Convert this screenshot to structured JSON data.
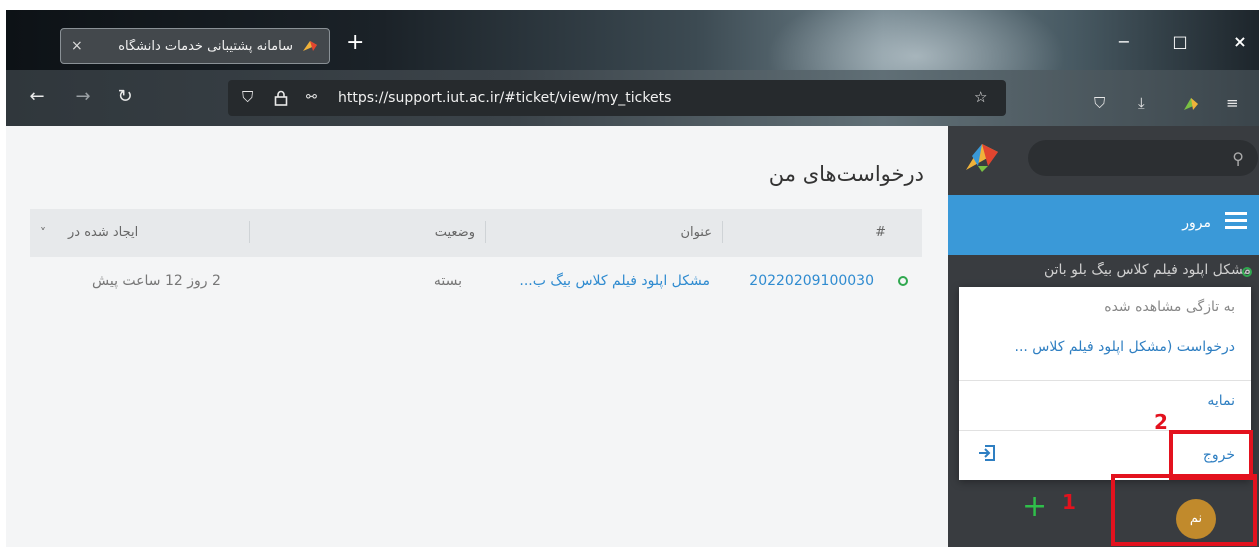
{
  "browser": {
    "tab_title": "سامانه پشتیبانی خدمات دانشگاه",
    "tab_close": "×",
    "new_tab": "+",
    "url": "https://support.iut.ac.ir/#ticket/view/my_tickets",
    "window": {
      "minimize": "−",
      "maximize": "□",
      "close": "×"
    }
  },
  "page": {
    "title": "درخواست‌های من",
    "columns": {
      "number": "#",
      "title": "عنوان",
      "status": "وضعیت",
      "created": "ایجاد شده در",
      "created_sort": "˅"
    },
    "rows": [
      {
        "number": "20220209100030",
        "title": "مشکل اپلود فیلم کلاس بیگ ب...",
        "status": "بسته",
        "created": "2 روز 12 ساعت پیش"
      }
    ]
  },
  "sidebar": {
    "overview_label": "مرور",
    "ticket_text": "مشکل اپلود فیلم کلاس بیگ بلو باتن"
  },
  "user_menu": {
    "recent_header": "به تازگی مشاهده شده",
    "recent_item": "درخواست (مشکل اپلود فیلم کلاس ...",
    "profile": "نمایه",
    "logout": "خروج"
  },
  "avatar_initials": "نم",
  "annotations": {
    "step1": "1",
    "step2": "2"
  },
  "colors": {
    "accent": "#3a99d8",
    "link": "#2f8bd0",
    "status_ok": "#2fa84f",
    "annotation": "#e3121e",
    "avatar": "#c18a2c"
  }
}
